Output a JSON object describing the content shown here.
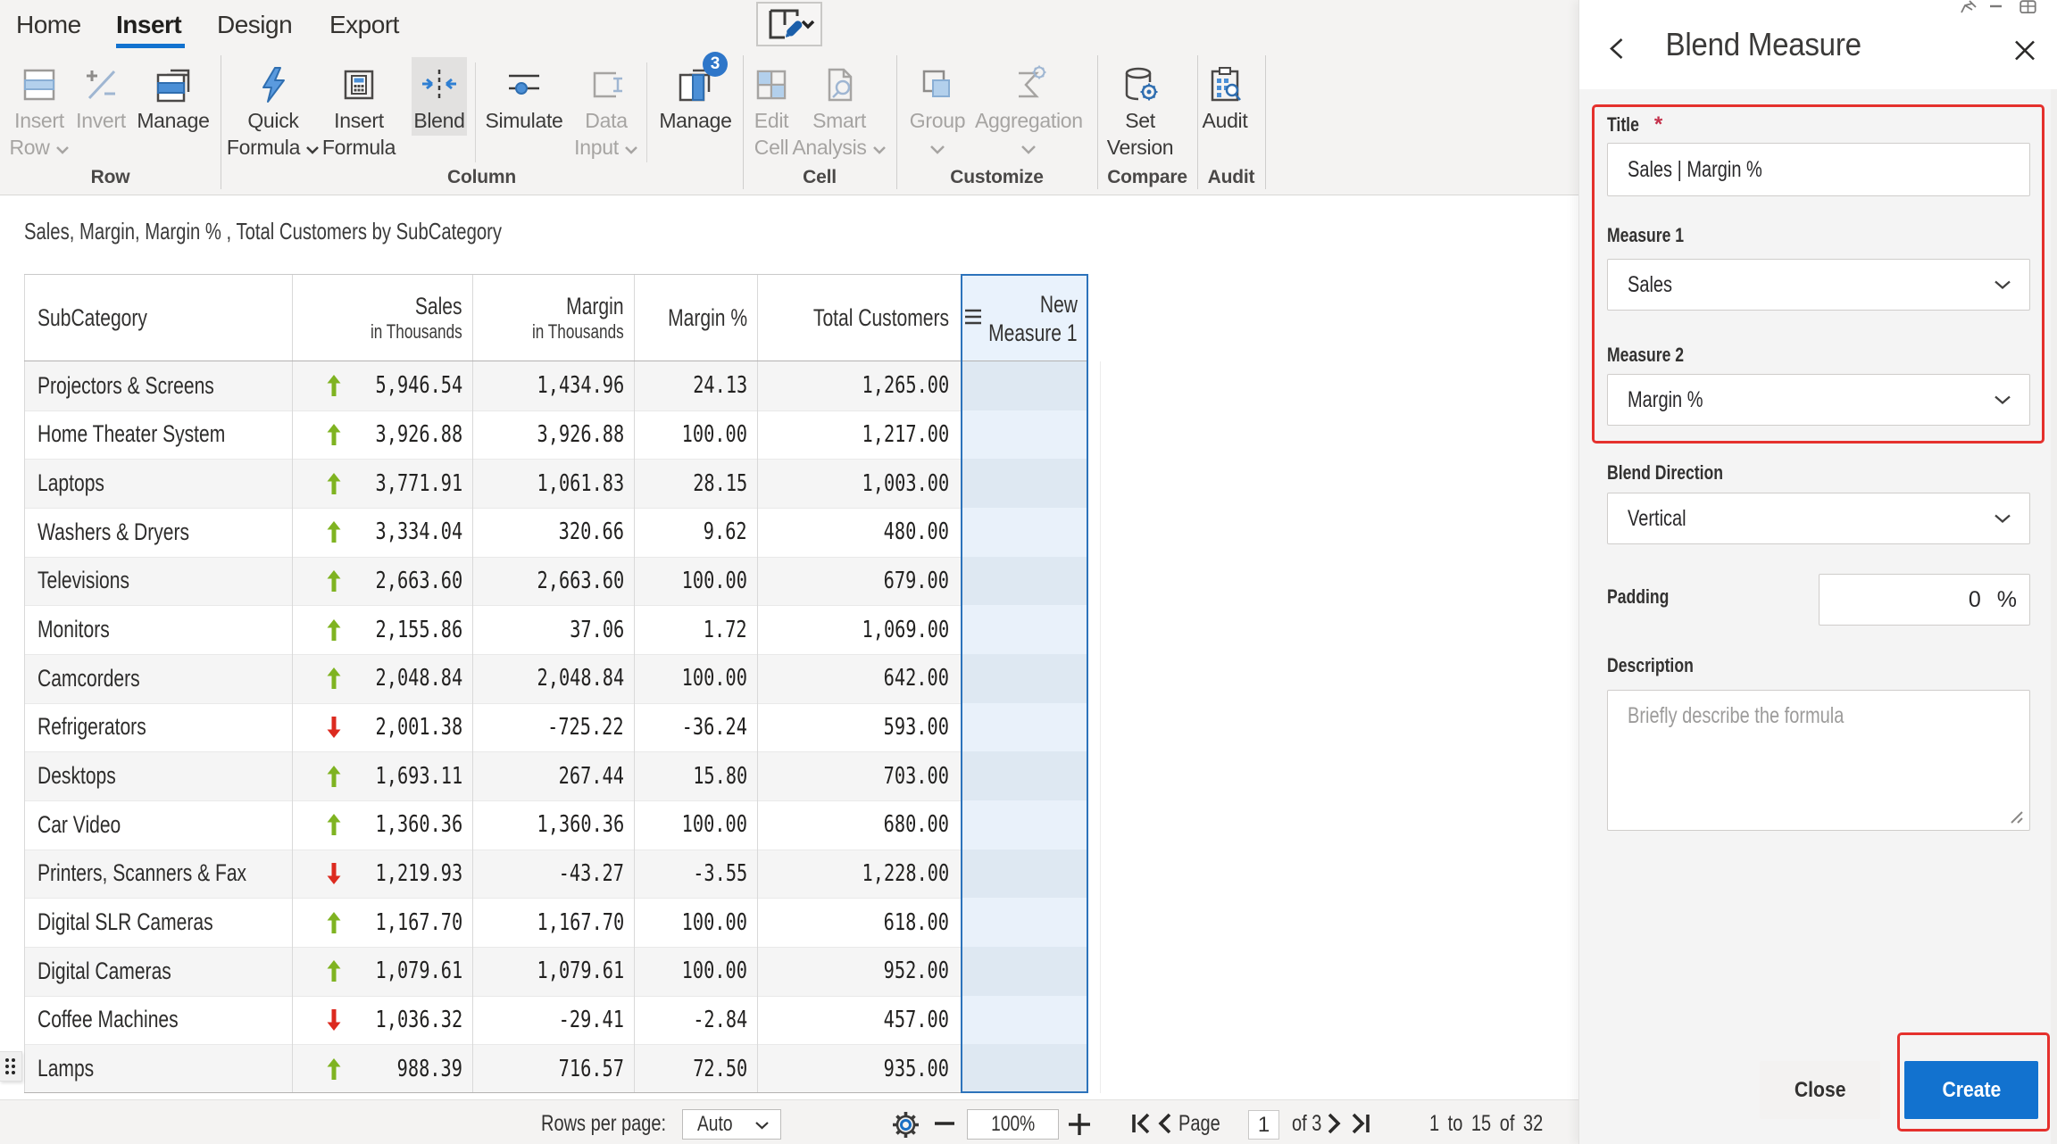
{
  "colors": {
    "accent": "#1272cf",
    "ribbon_bg": "#f4f3f2",
    "annotation_red": "#e5312d",
    "trend_up_green": "#7fb321",
    "trend_down_red": "#dc2a1f",
    "selected_column_border": "#2d73bb",
    "selected_column_header_bg": "#e9f2fc",
    "badge_blue": "#2e76c9"
  },
  "ribbon": {
    "tabs": [
      {
        "label": "Home",
        "active": false
      },
      {
        "label": "Insert",
        "active": true
      },
      {
        "label": "Design",
        "active": false
      },
      {
        "label": "Export",
        "active": false
      }
    ],
    "groups": [
      {
        "label": "Row"
      },
      {
        "label": "Column"
      },
      {
        "label": "Cell"
      },
      {
        "label": "Customize"
      },
      {
        "label": "Compare"
      },
      {
        "label": "Audit"
      }
    ],
    "buttons": {
      "insert_row": {
        "line1": "Insert",
        "line2": "Row",
        "disabled": true,
        "chevron": true
      },
      "invert": {
        "line1": "Invert",
        "line2": "",
        "disabled": true,
        "chevron": false
      },
      "manage_rows": {
        "line1": "Manage",
        "line2": "",
        "disabled": false,
        "chevron": false
      },
      "quick_formula": {
        "line1": "Quick",
        "line2": "Formula",
        "disabled": false,
        "chevron": true
      },
      "insert_formula": {
        "line1": "Insert",
        "line2": "Formula",
        "disabled": false,
        "chevron": false
      },
      "blend": {
        "line1": "Blend",
        "line2": "",
        "disabled": false,
        "chevron": false,
        "active": true
      },
      "simulate": {
        "line1": "Simulate",
        "line2": "",
        "disabled": false,
        "chevron": false
      },
      "data_input": {
        "line1": "Data",
        "line2": "Input",
        "disabled": true,
        "chevron": true
      },
      "manage_columns": {
        "line1": "Manage",
        "line2": "",
        "disabled": false,
        "chevron": false,
        "badge": "3"
      },
      "edit_cell": {
        "line1": "Edit",
        "line2": "Cell",
        "disabled": true,
        "chevron": false
      },
      "smart_analysis": {
        "line1": "Smart",
        "line2": "Analysis",
        "disabled": true,
        "chevron": true
      },
      "group": {
        "line1": "Group",
        "line2": "",
        "disabled": true,
        "chevron": true
      },
      "aggregation": {
        "line1": "Aggregation",
        "line2": "",
        "disabled": true,
        "chevron": true
      },
      "set_version": {
        "line1": "Set",
        "line2": "Version",
        "disabled": false,
        "chevron": false
      },
      "audit": {
        "line1": "Audit",
        "line2": "",
        "disabled": false,
        "chevron": false
      }
    }
  },
  "content": {
    "title": "Sales, Margin, Margin % , Total Customers by SubCategory",
    "table": {
      "columns": [
        {
          "label": "SubCategory",
          "sub": "",
          "align": "left"
        },
        {
          "label": "Sales",
          "sub": "in Thousands",
          "align": "right"
        },
        {
          "label": "Margin",
          "sub": "in Thousands",
          "align": "right"
        },
        {
          "label": "Margin %",
          "sub": "",
          "align": "right"
        },
        {
          "label": "Total Customers",
          "sub": "",
          "align": "right"
        },
        {
          "label": "New",
          "sub": "Measure 1",
          "align": "right",
          "selected": true
        }
      ],
      "rows": [
        {
          "subcategory": "Projectors & Screens",
          "trend": "up",
          "sales": "5,946.54",
          "margin": "1,434.96",
          "margin_pct": "24.13",
          "total_customers": "1,265.00"
        },
        {
          "subcategory": "Home Theater System",
          "trend": "up",
          "sales": "3,926.88",
          "margin": "3,926.88",
          "margin_pct": "100.00",
          "total_customers": "1,217.00"
        },
        {
          "subcategory": "Laptops",
          "trend": "up",
          "sales": "3,771.91",
          "margin": "1,061.83",
          "margin_pct": "28.15",
          "total_customers": "1,003.00"
        },
        {
          "subcategory": "Washers & Dryers",
          "trend": "up",
          "sales": "3,334.04",
          "margin": "320.66",
          "margin_pct": "9.62",
          "total_customers": "480.00"
        },
        {
          "subcategory": "Televisions",
          "trend": "up",
          "sales": "2,663.60",
          "margin": "2,663.60",
          "margin_pct": "100.00",
          "total_customers": "679.00"
        },
        {
          "subcategory": "Monitors",
          "trend": "up",
          "sales": "2,155.86",
          "margin": "37.06",
          "margin_pct": "1.72",
          "total_customers": "1,069.00"
        },
        {
          "subcategory": "Camcorders",
          "trend": "up",
          "sales": "2,048.84",
          "margin": "2,048.84",
          "margin_pct": "100.00",
          "total_customers": "642.00"
        },
        {
          "subcategory": "Refrigerators",
          "trend": "down",
          "sales": "2,001.38",
          "margin": "-725.22",
          "margin_pct": "-36.24",
          "total_customers": "593.00"
        },
        {
          "subcategory": "Desktops",
          "trend": "up",
          "sales": "1,693.11",
          "margin": "267.44",
          "margin_pct": "15.80",
          "total_customers": "703.00"
        },
        {
          "subcategory": "Car Video",
          "trend": "up",
          "sales": "1,360.36",
          "margin": "1,360.36",
          "margin_pct": "100.00",
          "total_customers": "680.00"
        },
        {
          "subcategory": "Printers, Scanners & Fax",
          "trend": "down",
          "sales": "1,219.93",
          "margin": "-43.27",
          "margin_pct": "-3.55",
          "total_customers": "1,228.00"
        },
        {
          "subcategory": "Digital SLR Cameras",
          "trend": "up",
          "sales": "1,167.70",
          "margin": "1,167.70",
          "margin_pct": "100.00",
          "total_customers": "618.00"
        },
        {
          "subcategory": "Digital Cameras",
          "trend": "up",
          "sales": "1,079.61",
          "margin": "1,079.61",
          "margin_pct": "100.00",
          "total_customers": "952.00"
        },
        {
          "subcategory": "Coffee Machines",
          "trend": "down",
          "sales": "1,036.32",
          "margin": "-29.41",
          "margin_pct": "-2.84",
          "total_customers": "457.00"
        },
        {
          "subcategory": "Lamps",
          "trend": "up",
          "sales": "988.39",
          "margin": "716.57",
          "margin_pct": "72.50",
          "total_customers": "935.00"
        }
      ]
    },
    "footer": {
      "rows_per_page_label": "Rows per page:",
      "rows_per_page_value": "Auto",
      "zoom_value": "100%",
      "page_label": "Page",
      "page_current": "1",
      "page_of": "of 3",
      "range_text": "1 to 15 of 32"
    }
  },
  "panel": {
    "title": "Blend Measure",
    "fields": {
      "title": {
        "label": "Title",
        "required": "*",
        "value": "Sales | Margin %"
      },
      "measure1": {
        "label": "Measure 1",
        "value": "Sales"
      },
      "measure2": {
        "label": "Measure 2",
        "value": "Margin %"
      },
      "blend_direction": {
        "label": "Blend Direction",
        "value": "Vertical"
      },
      "padding": {
        "label": "Padding",
        "value": "0",
        "unit": "%"
      },
      "description": {
        "label": "Description",
        "placeholder": "Briefly describe the formula"
      }
    },
    "buttons": {
      "close": "Close",
      "create": "Create"
    }
  }
}
